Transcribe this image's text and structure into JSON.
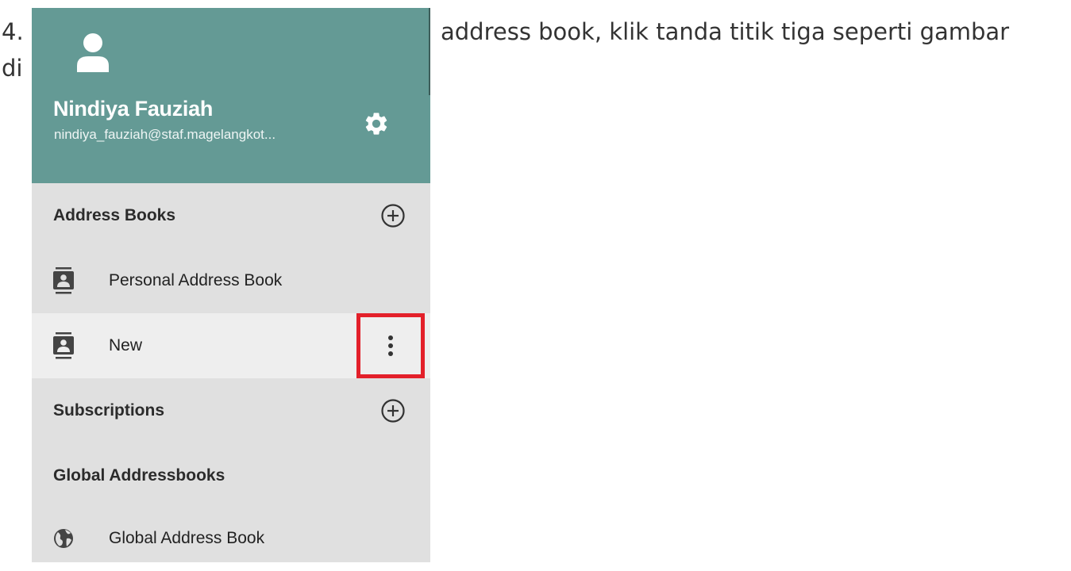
{
  "document": {
    "line1_number": "4.",
    "line1_text": "address book, klik tanda titik tiga seperti gambar",
    "line2_text": "di"
  },
  "account": {
    "name": "Nindiya Fauziah",
    "email": "nindiya_fauziah@staf.magelangkot..."
  },
  "sections": {
    "address_books": "Address Books",
    "subscriptions": "Subscriptions",
    "global_addressbooks": "Global Addressbooks"
  },
  "items": {
    "personal": "Personal Address Book",
    "new": "New",
    "global": "Global Address Book"
  },
  "colors": {
    "header": "#649a95",
    "panel": "#e0e0e0",
    "selected_row": "#eeeeee",
    "highlight": "#e3202a"
  },
  "icons": [
    "user-icon",
    "gear-icon",
    "plus-circle-icon",
    "address-book-icon",
    "more-vertical-icon",
    "globe-icon"
  ]
}
